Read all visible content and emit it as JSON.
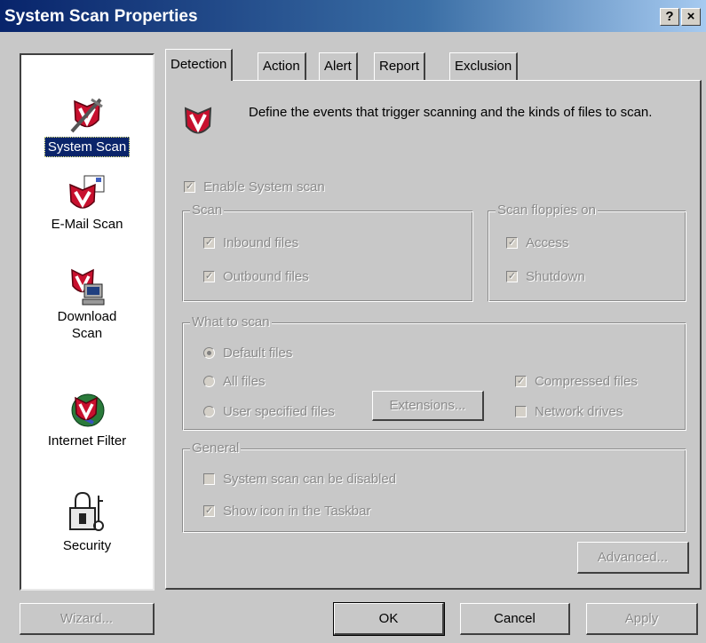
{
  "window": {
    "title": "System Scan Properties",
    "help_label": "?",
    "close_label": "×"
  },
  "sidebar": {
    "items": [
      {
        "label": "System Scan",
        "icon": "system-scan-icon",
        "selected": true
      },
      {
        "label": "E-Mail Scan",
        "icon": "email-scan-icon"
      },
      {
        "label": "Download\nScan",
        "icon": "download-scan-icon"
      },
      {
        "label": "Internet Filter",
        "icon": "internet-filter-icon"
      },
      {
        "label": "Security",
        "icon": "padlock-icon"
      }
    ]
  },
  "tabs": [
    "Detection",
    "Action",
    "Alert",
    "Report",
    "Exclusion"
  ],
  "active_tab": "Detection",
  "description": "Define the events that trigger scanning and the kinds of files to scan.",
  "enable_system_scan": {
    "label": "Enable System scan",
    "checked": true
  },
  "scan_group": {
    "title": "Scan",
    "inbound": {
      "label": "Inbound files",
      "checked": true
    },
    "outbound": {
      "label": "Outbound files",
      "checked": true
    }
  },
  "floppies_group": {
    "title": "Scan floppies on",
    "access": {
      "label": "Access",
      "checked": true
    },
    "shutdown": {
      "label": "Shutdown",
      "checked": true
    }
  },
  "what_group": {
    "title": "What to scan",
    "default_files": {
      "label": "Default files",
      "selected": true
    },
    "all_files": {
      "label": "All files",
      "selected": false
    },
    "user_specified": {
      "label": "User specified files",
      "selected": false
    },
    "extensions_label": "Extensions...",
    "compressed": {
      "label": "Compressed files",
      "checked": true
    },
    "network": {
      "label": "Network drives",
      "checked": false
    }
  },
  "general_group": {
    "title": "General",
    "can_disable": {
      "label": "System scan can be disabled",
      "checked": false
    },
    "show_icon": {
      "label": "Show icon in the Taskbar",
      "checked": true
    }
  },
  "buttons": {
    "advanced": "Advanced...",
    "wizard": "Wizard...",
    "ok": "OK",
    "cancel": "Cancel",
    "apply": "Apply"
  },
  "colors": {
    "title_start": "#08246b",
    "selection": "#0a246a",
    "shield_red": "#c8102e",
    "face": "#c8c8c8"
  }
}
